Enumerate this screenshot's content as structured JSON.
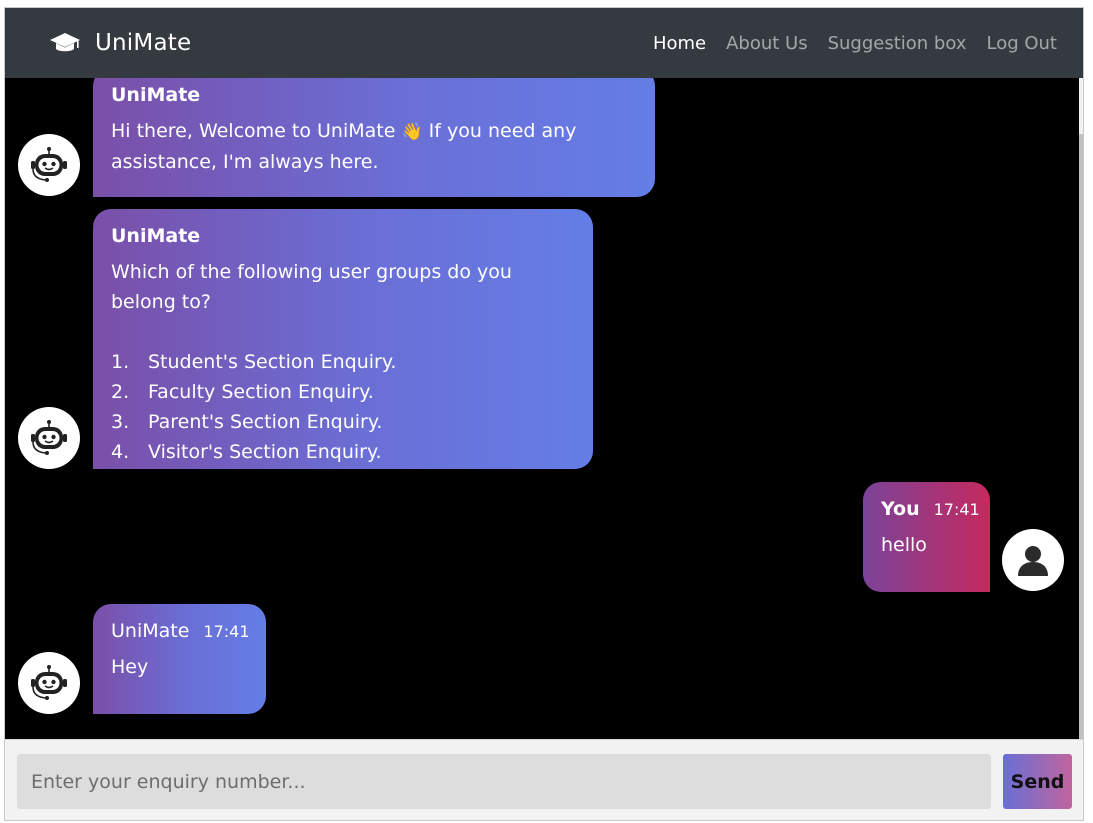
{
  "navbar": {
    "brand": "UniMate",
    "links": [
      {
        "label": "Home"
      },
      {
        "label": "About Us"
      },
      {
        "label": "Suggestion box"
      },
      {
        "label": "Log Out"
      }
    ]
  },
  "messages": [
    {
      "sender": "UniMate",
      "text_before_emoji": "Hi there, Welcome to UniMate ",
      "emoji": "👋",
      "text_after_emoji": " If you need any assistance, I'm always here."
    },
    {
      "sender": "UniMate",
      "text": "Which of the following user groups do you belong to?",
      "list": [
        {
          "num": "1.",
          "text": "Student's Section Enquiry."
        },
        {
          "num": "2.",
          "text": "Faculty Section Enquiry."
        },
        {
          "num": "3.",
          "text": "Parent's Section Enquiry."
        },
        {
          "num": "4.",
          "text": "Visitor's Section Enquiry."
        }
      ]
    },
    {
      "sender": "You",
      "time": "17:41",
      "text": "hello"
    },
    {
      "sender": "UniMate",
      "time": "17:41",
      "text": "Hey"
    }
  ],
  "footer": {
    "placeholder": "Enter your enquiry number...",
    "send_label": "Send"
  },
  "icons": {
    "brand": "graduation-cap-icon",
    "bot_avatar": "robot-icon",
    "user_avatar": "user-icon"
  },
  "colors": {
    "navbar": "#343a40",
    "bot_bubble_start": "#7a4fa8",
    "bot_bubble_end": "#647ee6",
    "user_bubble_start": "#7b4398",
    "user_bubble_end": "#c5295e"
  }
}
